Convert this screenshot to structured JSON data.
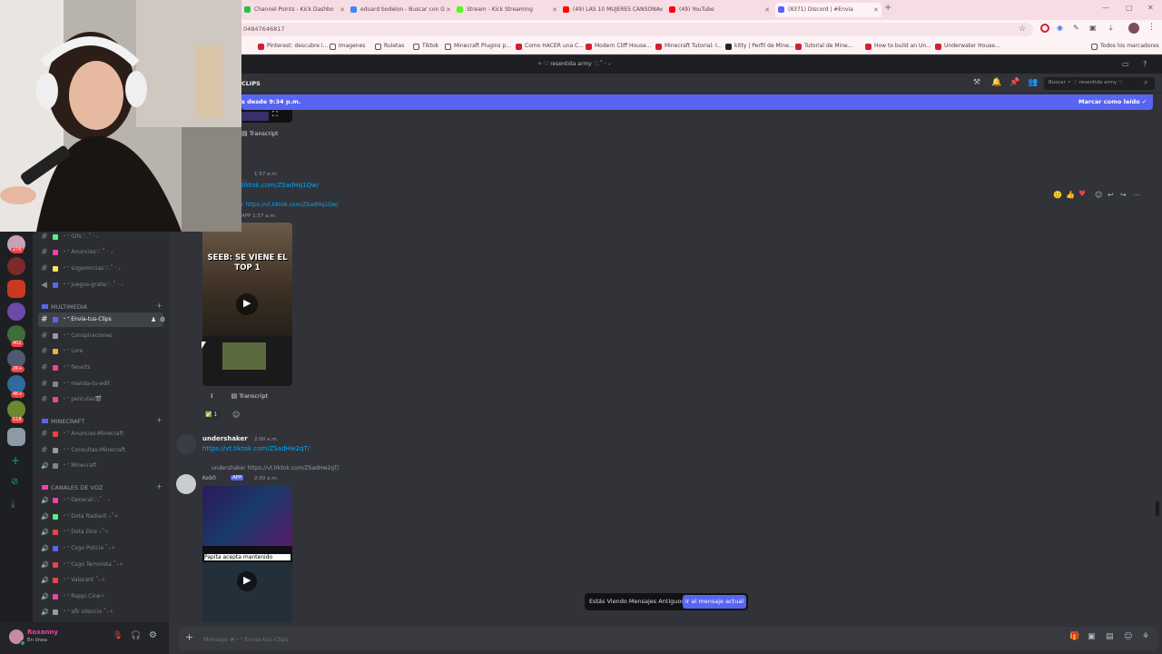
{
  "browser": {
    "tabs": [
      {
        "label": "Channel Points - Kick Dashbo",
        "color": "#2bbf4a"
      },
      {
        "label": "eduard bodelon - Buscar con G",
        "color": "#4285f4"
      },
      {
        "label": "Stream - Kick Streaming",
        "color": "#53fc18"
      },
      {
        "label": "(49) LAS 10 MUJERES CANSONA",
        "color": "#ff0000"
      },
      {
        "label": "(49) YouTube",
        "color": "#ff0000"
      },
      {
        "label": "(8371) Discord | #Envia",
        "color": "#5865f2"
      }
    ],
    "url": "04847646817",
    "bookmarks": [
      "Pinterest: descubre i...",
      "Imagenes",
      "Ruletas",
      "Tiktok",
      "Minecraft Plugins p...",
      "Como HACER una C...",
      "Modern Cliff House...",
      "Minecraft Tutorial: I...",
      "kitty | Perfil de Mine...",
      "Tutorial de Mine...",
      "How to build an Un...",
      "Underwater House...",
      "Todos los marcadores"
    ]
  },
  "discord": {
    "server_name": "✧ ♡ resentida army ♡.˚ ‧ ₊",
    "channel_title": "Clips",
    "search_placeholder": "Buscar ✧ ♡ resentida army ♡",
    "new_messages_banner": "s desde 9:34 p.m.",
    "mark_read": "Marcar como leído",
    "server_badges": [
      "276",
      "402",
      "2K+",
      "4K+",
      "518"
    ],
    "channels": [
      {
        "glyph": "#",
        "name": "・ᐩ Gifs♡.˚ ‧ ₊",
        "color": "#57f287"
      },
      {
        "glyph": "#",
        "name": "・ᐩ Anuncios♡.˚ ‧ ₊",
        "color": "#eb459e"
      },
      {
        "glyph": "#",
        "name": "・ᐩ sugerencias♡.˚ ‧ ₊",
        "color": "#fee75c"
      },
      {
        "glyph": "◀",
        "name": "・ᐩ juegos-gratis♡.˚ ‧ ₊",
        "color": "#5865f2"
      }
    ],
    "category_multimedia": "Multimedia",
    "multimedia_channels": [
      {
        "glyph": "#",
        "name": "・ᐩ Envia-tus-Clips",
        "selected": true,
        "color": "#5865f2"
      },
      {
        "glyph": "#",
        "name": "・ᐩ Conspiraciones",
        "color": "#949ba4"
      },
      {
        "glyph": "#",
        "name": "・ᐩ Lore",
        "color": "#f0b232"
      },
      {
        "glyph": "#",
        "name": "・ᐩ fanarts",
        "color": "#eb459e"
      },
      {
        "glyph": "#",
        "name": "・ᐩ manda-tu-edit",
        "color": "#80848e"
      },
      {
        "glyph": "#",
        "name": "・ᐩ peliculas🎬",
        "color": "#eb459e"
      }
    ],
    "category_minecraft": "Minecraft",
    "minecraft_channels": [
      {
        "glyph": "#",
        "name": "・ᐩ Anuncios-Minecraft",
        "color": "#ed4245"
      },
      {
        "glyph": "#",
        "name": "・ᐩ Consultas-Minecraft",
        "color": "#949ba4"
      },
      {
        "glyph": "🔊",
        "name": "・ᐩ Minecraft",
        "color": "#80848e"
      }
    ],
    "category_voice": "Canales de voz",
    "voice_channels": [
      {
        "glyph": "🔊",
        "name": "・ᐩ General♡.˚ ‧ ₊",
        "color": "#eb459e"
      },
      {
        "glyph": "🔊",
        "name": "・ᐩ Dota Radiant ₊˚✧",
        "color": "#57f287"
      },
      {
        "glyph": "🔊",
        "name": "・ᐩ Dota Dire ₊˚✧",
        "color": "#ed4245"
      },
      {
        "glyph": "🔊",
        "name": "・ᐩ Csgo Policia ˚₊✧",
        "color": "#5865f2"
      },
      {
        "glyph": "🔊",
        "name": "・ᐩ Csgo Terrorista ˚₊✧",
        "color": "#ed4245"
      },
      {
        "glyph": "🔊",
        "name": "・ᐩ Valorant ˚₊✧",
        "color": "#ed4245"
      },
      {
        "glyph": "🔊",
        "name": "・ᐩ Rappi Cine✧",
        "color": "#eb459e"
      },
      {
        "glyph": "🔊",
        "name": "・ᐩ afk silencio ˚₊✧",
        "color": "#949ba4"
      }
    ],
    "user": {
      "name": "Roxanny",
      "status": "En línea"
    },
    "messages": {
      "m1_transcript": "Transcript",
      "m2_time": "1:57 a.m.",
      "m2_link": "tiktok.com/ZSadHq1Qw/",
      "m2_reply_link": "r https://vt.tiktok.com/ZSadHq1Qw/",
      "m2_app_time": "APP  1:57 a.m.",
      "m2_video_title": "SEEB: SE VIENE EL TOP 1",
      "m2_transcript": "Transcript",
      "m2_reaction_count": "1",
      "m3_user": "undershaker",
      "m3_time": "2:00 a.m.",
      "m3_link": "https://vt.tiktok.com/ZSadHw2qT/",
      "m3_reply": "undershaker https://vt.tiktok.com/ZSadHw2qT/",
      "m3_app_user": "Keb0",
      "m3_app_tag": "APP",
      "m3_app_time": "2:00 a.m.",
      "m3_caption": "Papita acepta mantenido"
    },
    "old_messages_notice": "Estás Viendo Mensajes Antiguos",
    "jump_to_present": "Ir al mensaje actual",
    "composer_placeholder": "Mensaje #・ᐩ Envia-tus-Clips"
  }
}
